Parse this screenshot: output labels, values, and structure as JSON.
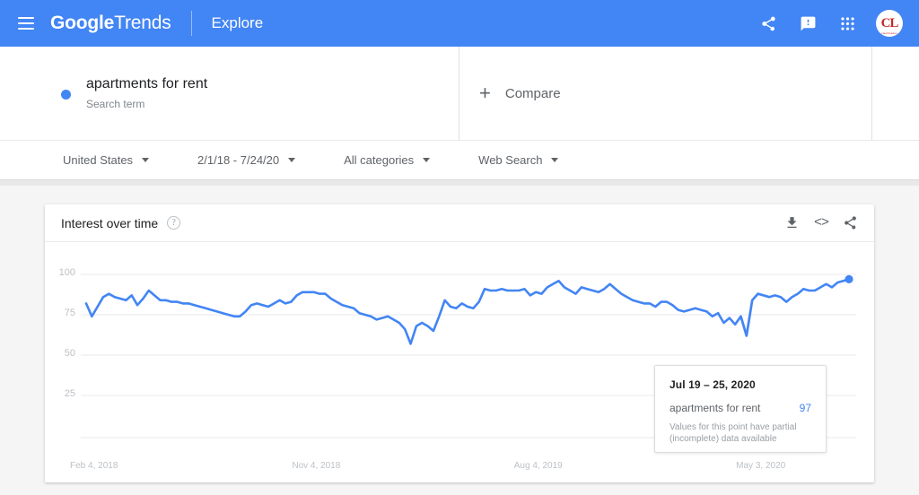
{
  "appbar": {
    "menu_icon": "hamburger-icon",
    "brand_google": "Google",
    "brand_trends": "Trends",
    "explore": "Explore",
    "share_icon": "share-icon",
    "feedback_icon": "feedback-icon",
    "apps_icon": "apps-grid-icon",
    "avatar_initials": "CL",
    "avatar_sub": "clasificados",
    "brand_color": "#4285f4"
  },
  "query": {
    "term": "apartments for rent",
    "type_label": "Search term",
    "dot_color": "#4285f4",
    "compare_label": "Compare",
    "compare_plus": "+"
  },
  "filters": [
    {
      "label": "United States"
    },
    {
      "label": "2/1/18 - 7/24/20"
    },
    {
      "label": "All categories"
    },
    {
      "label": "Web Search"
    }
  ],
  "card": {
    "title": "Interest over time",
    "help_icon": "help-circle-icon",
    "help_glyph": "?",
    "download_icon": "download-icon",
    "embed_icon": "embed-code-icon",
    "embed_glyph": "<>",
    "share_icon": "share-icon"
  },
  "tooltip": {
    "date": "Jul 19 – 25, 2020",
    "term": "apartments for rent",
    "value": "97",
    "note": "Values for this point have partial (incomplete) data available",
    "value_color": "#4285f4"
  },
  "chart_data": {
    "type": "line",
    "title": "Interest over time",
    "xlabel": "",
    "ylabel": "",
    "ylim": [
      0,
      110
    ],
    "yticks": [
      25,
      50,
      75,
      100
    ],
    "ytick_labels": [
      "25",
      "50",
      "75",
      "100"
    ],
    "grid": true,
    "legend": "none",
    "line_color": "#4285f4",
    "xtick_labels": [
      "Feb 4, 2018",
      "Nov 4, 2018",
      "Aug 4, 2019",
      "May 3, 2020"
    ],
    "xtick_index": [
      0,
      39,
      78,
      117
    ],
    "series": [
      {
        "name": "apartments for rent",
        "values": [
          82,
          74,
          80,
          86,
          88,
          86,
          85,
          84,
          87,
          81,
          85,
          90,
          87,
          84,
          84,
          83,
          83,
          82,
          82,
          81,
          80,
          79,
          78,
          77,
          76,
          75,
          74,
          74,
          77,
          81,
          82,
          81,
          80,
          82,
          84,
          82,
          83,
          87,
          89,
          89,
          89,
          88,
          88,
          85,
          83,
          81,
          80,
          79,
          76,
          75,
          74,
          72,
          73,
          74,
          72,
          70,
          66,
          57,
          68,
          70,
          68,
          65,
          74,
          84,
          80,
          79,
          82,
          80,
          79,
          83,
          91,
          90,
          90,
          91,
          90,
          90,
          90,
          91,
          87,
          89,
          88,
          92,
          94,
          96,
          92,
          90,
          88,
          92,
          91,
          90,
          89,
          91,
          94,
          91,
          88,
          86,
          84,
          83,
          82,
          82,
          80,
          83,
          83,
          81,
          78,
          77,
          78,
          79,
          78,
          77,
          74,
          76,
          70,
          73,
          69,
          74,
          62,
          84,
          88,
          87,
          86,
          87,
          86,
          83,
          86,
          88,
          91,
          90,
          90,
          92,
          94,
          92,
          95,
          96,
          97
        ]
      }
    ],
    "highlight_point": {
      "index": 134,
      "value": 97,
      "label": "Jul 19 – 25, 2020"
    },
    "partial_data_note": "Values for this point have partial (incomplete) data available"
  }
}
